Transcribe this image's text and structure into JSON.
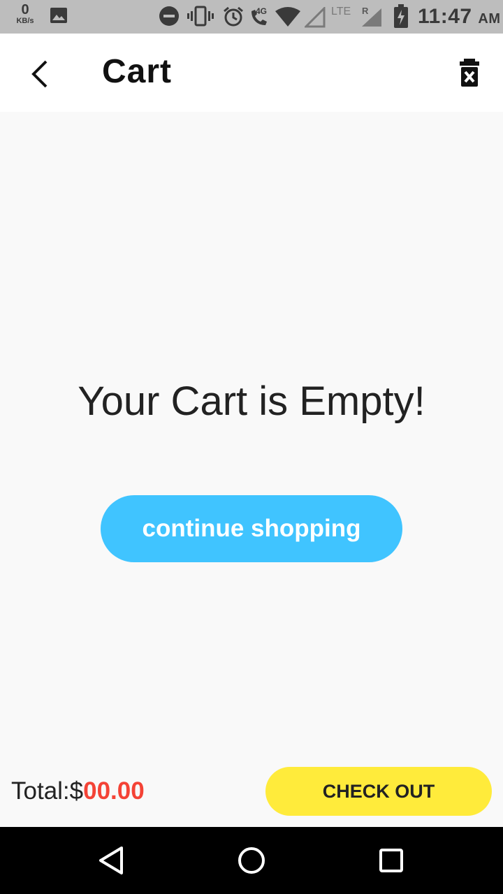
{
  "status_bar": {
    "net_speed_value": "0",
    "net_speed_unit": "KB/s",
    "network_4g": "4G",
    "network_lte": "LTE",
    "roaming": "R",
    "time": "11:47",
    "ampm": "AM",
    "icons": [
      "image-icon",
      "do-not-disturb-icon",
      "vibrate-icon",
      "alarm-icon",
      "wifi-call-icon",
      "wifi-icon",
      "signal-icon",
      "signal-roaming-icon",
      "battery-charging-icon"
    ]
  },
  "app_bar": {
    "title": "Cart",
    "back_icon": "back-arrow-icon",
    "clear_icon": "delete-forever-icon"
  },
  "main": {
    "empty_message": "Your Cart is Empty!",
    "continue_label": "continue shopping"
  },
  "bottom": {
    "total_label": "Total:$",
    "total_amount": "00.00",
    "checkout_label": "CHECK OUT"
  },
  "colors": {
    "accent_blue": "#40c4ff",
    "checkout_yellow": "#ffeb3b",
    "amount_red": "#f44336"
  },
  "nav_bar": {
    "icons": [
      "nav-back-icon",
      "nav-home-icon",
      "nav-recents-icon"
    ]
  }
}
